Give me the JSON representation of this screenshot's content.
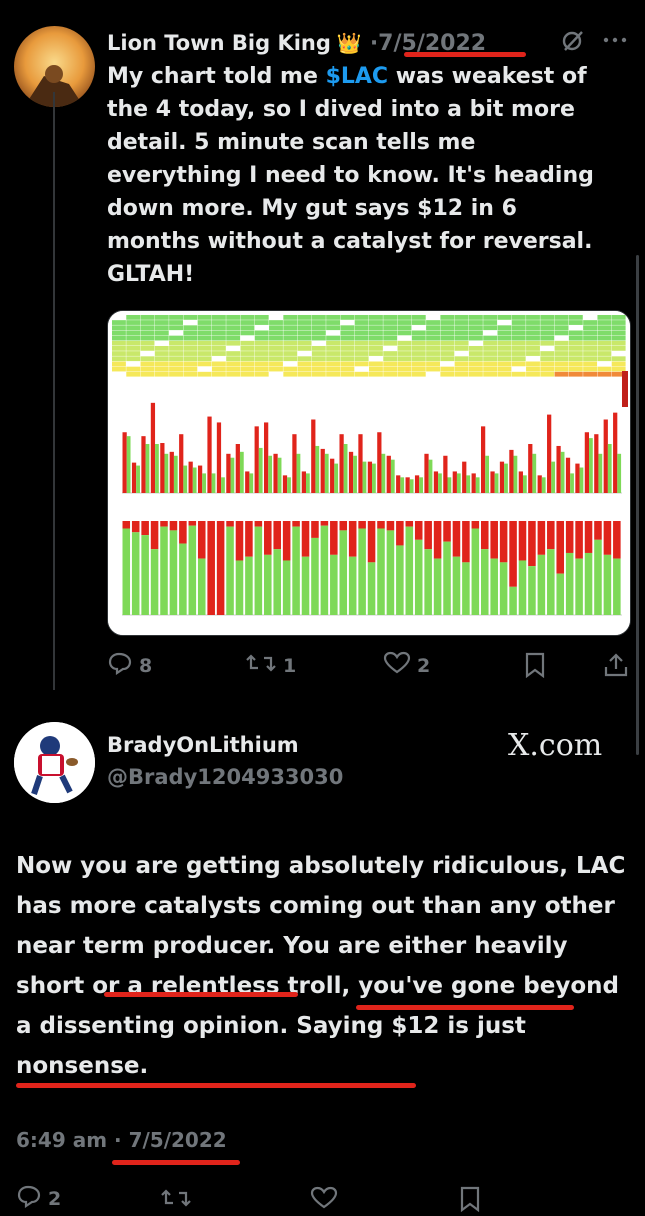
{
  "tweet1": {
    "author": "Lion Town Big King",
    "crown": "👑",
    "date": "·7/5/2022",
    "text_before_cashtag": "My chart told me ",
    "cashtag": "$LAC",
    "text_after_cashtag": " was weakest of the 4 today, so I dived into a bit more detail. 5 minute scan tells me everything I need to know. It's heading down more. My gut says $12 in 6 months without a catalyst for reversal. GLTAH!",
    "replies": "8",
    "retweets": "1",
    "likes": "2"
  },
  "tweet2": {
    "author": "BradyOnLithium",
    "handle": "@Brady1204933030",
    "watermark": "X.com",
    "text_1": "Now you are getting absolutely ridiculous, LAC has more catalysts coming out than any other near term producer. You are either ",
    "text_hl1": "heavily short",
    "text_2": " or a ",
    "text_hl2": "relentless troll",
    "text_3": ", you've gone beyond a dissenting opinion. ",
    "text_hl3": "Saying $12 is just nonsense.",
    "time": "6:49 am",
    "date": "· 7/5/2022",
    "replies": "2"
  },
  "icons": [
    "more-icon",
    "grok-icon",
    "reply-icon",
    "retweet-icon",
    "like-icon",
    "bookmark-icon",
    "share-icon"
  ],
  "colors": {
    "accent": "#1d9bf0",
    "underline": "#e0241b",
    "bar_red": "#e0241b",
    "bar_green": "#7ed957"
  },
  "chart_data": {
    "type": "bar",
    "title": "",
    "red_values": [
      62,
      31,
      58,
      92,
      51,
      42,
      60,
      32,
      28,
      78,
      72,
      40,
      50,
      22,
      68,
      72,
      40,
      18,
      60,
      22,
      75,
      45,
      35,
      60,
      42,
      60,
      32,
      62,
      38,
      18,
      16,
      18,
      40,
      22,
      38,
      22,
      32,
      20,
      68,
      22,
      32,
      44,
      22,
      50,
      18,
      80,
      48,
      36,
      30,
      62,
      60,
      75,
      82
    ],
    "green_values": [
      58,
      28,
      50,
      50,
      40,
      38,
      28,
      26,
      20,
      20,
      16,
      36,
      42,
      20,
      46,
      38,
      36,
      16,
      40,
      20,
      48,
      40,
      30,
      50,
      38,
      32,
      30,
      40,
      34,
      16,
      14,
      16,
      34,
      20,
      16,
      20,
      18,
      16,
      38,
      20,
      30,
      38,
      18,
      40,
      16,
      32,
      42,
      20,
      26,
      56,
      40,
      50,
      40
    ],
    "stack_red_share": [
      0.08,
      0.12,
      0.15,
      0.3,
      0.06,
      0.1,
      0.24,
      0.05,
      0.4,
      1.0,
      1.0,
      0.06,
      0.42,
      0.38,
      0.06,
      0.36,
      0.3,
      0.42,
      0.06,
      0.38,
      0.18,
      0.05,
      0.36,
      0.1,
      0.38,
      0.08,
      0.44,
      0.08,
      0.1,
      0.26,
      0.06,
      0.2,
      0.3,
      0.4,
      0.22,
      0.38,
      0.44,
      0.08,
      0.3,
      0.4,
      0.44,
      0.7,
      0.42,
      0.48,
      0.36,
      0.3,
      0.56,
      0.34,
      0.4,
      0.34,
      0.2,
      0.36,
      0.4
    ]
  }
}
